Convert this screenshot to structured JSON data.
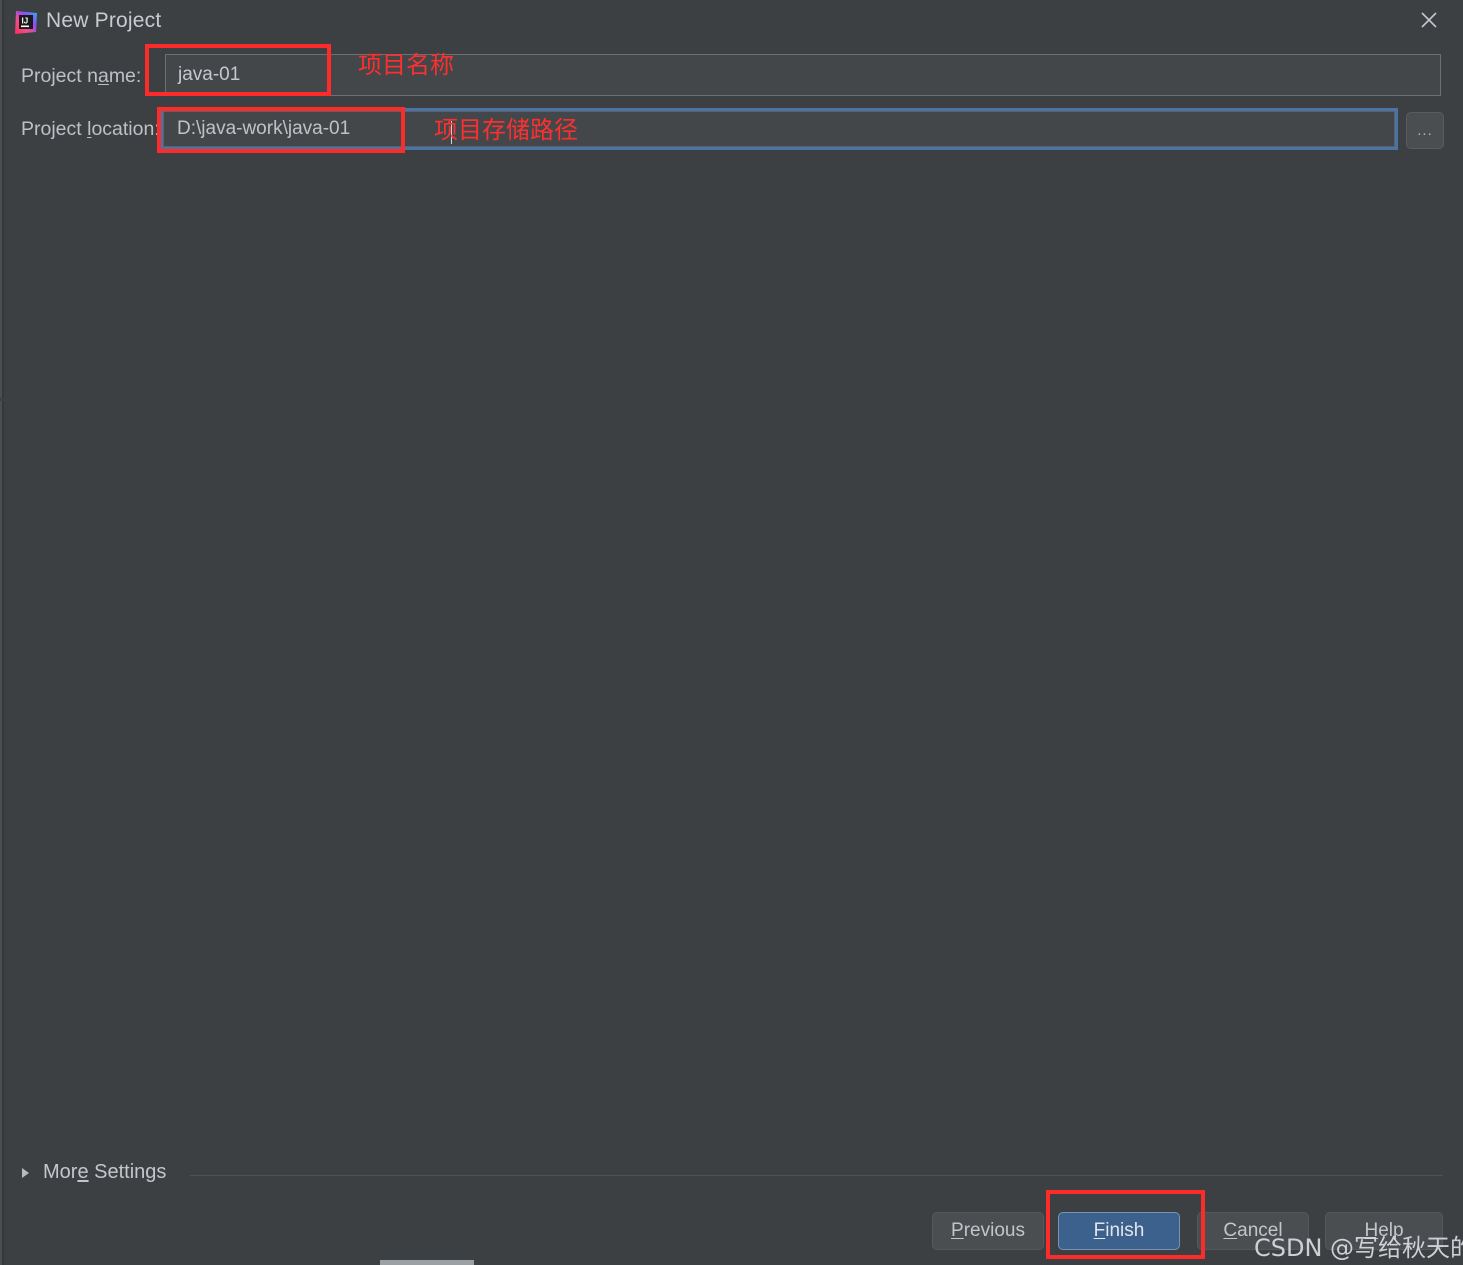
{
  "window": {
    "title": "New Project",
    "app_icon": "intellij-idea-icon",
    "close_icon": "close-icon",
    "background_color": "#3c4043"
  },
  "form": {
    "name_label_pre": "Project n",
    "name_label_mn": "a",
    "name_label_post": "me:",
    "name_value": "java-01",
    "location_label_pre": "Project ",
    "location_label_mn": "l",
    "location_label_post": "ocation:",
    "location_value": "D:\\java-work\\java-01",
    "browse_label": "...",
    "focus_color": "#4a74a8"
  },
  "annotations": {
    "name_note": "项目名称",
    "location_note": "项目存储路径",
    "highlight_color": "#fe2b2b"
  },
  "more_settings": {
    "label_pre": "Mor",
    "label_mn": "e",
    "label_post": " Settings",
    "expanded": false,
    "chevron_icon": "chevron-right-icon"
  },
  "buttons": {
    "previous": {
      "pre": "",
      "mn": "P",
      "post": "revious"
    },
    "finish": {
      "pre": "",
      "mn": "F",
      "post": "inish",
      "accent_color": "#3d618d"
    },
    "cancel": {
      "pre": "",
      "mn": "C",
      "post": "ancel"
    },
    "help": {
      "pre": "",
      "mn": "H",
      "post": "elp"
    }
  },
  "watermark": {
    "text": "CSDN @写给秋天的信"
  }
}
